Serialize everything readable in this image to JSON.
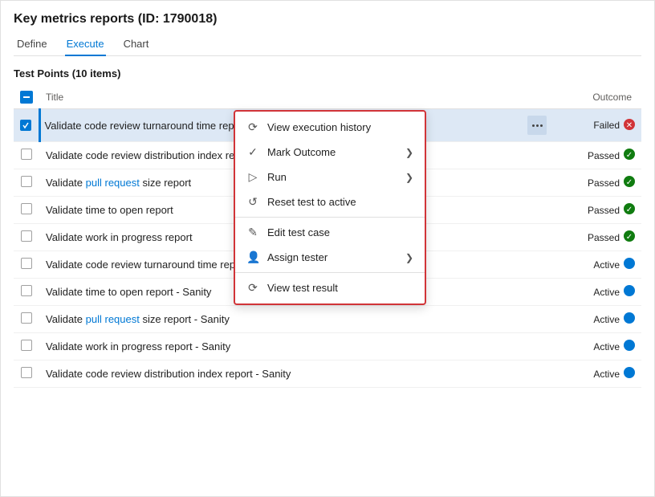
{
  "page": {
    "title": "Key metrics reports (ID: 1790018)"
  },
  "tabs": [
    {
      "id": "define",
      "label": "Define",
      "active": false
    },
    {
      "id": "execute",
      "label": "Execute",
      "active": true
    },
    {
      "id": "chart",
      "label": "Chart",
      "active": false
    }
  ],
  "section": {
    "title": "Test Points (10 items)"
  },
  "table": {
    "columns": [
      {
        "id": "checkbox",
        "label": ""
      },
      {
        "id": "title",
        "label": "Title"
      },
      {
        "id": "actions",
        "label": ""
      },
      {
        "id": "outcome",
        "label": "Outcome"
      }
    ],
    "rows": [
      {
        "id": 1,
        "title": "Validate code review turnaround time report - Data correctness",
        "titleLink": false,
        "selected": true,
        "checked": true,
        "outcome": "Failed",
        "outcomeType": "failed",
        "showMenu": true
      },
      {
        "id": 2,
        "title": "Validate code review distribution index report",
        "titleLink": false,
        "selected": false,
        "checked": false,
        "outcome": "Passed",
        "outcomeType": "passed",
        "showMenu": false
      },
      {
        "id": 3,
        "title": "Validate pull request size report",
        "titleLink": true,
        "selected": false,
        "checked": false,
        "outcome": "Passed",
        "outcomeType": "passed",
        "showMenu": false
      },
      {
        "id": 4,
        "title": "Validate time to open report",
        "titleLink": false,
        "selected": false,
        "checked": false,
        "outcome": "Passed",
        "outcomeType": "passed",
        "showMenu": false
      },
      {
        "id": 5,
        "title": "Validate work in progress report",
        "titleLink": false,
        "selected": false,
        "checked": false,
        "outcome": "Passed",
        "outcomeType": "passed",
        "showMenu": false
      },
      {
        "id": 6,
        "title": "Validate code review turnaround time report - Sanity",
        "titleLink": false,
        "selected": false,
        "checked": false,
        "outcome": "Active",
        "outcomeType": "active",
        "showMenu": false
      },
      {
        "id": 7,
        "title": "Validate time to open report - Sanity",
        "titleLink": false,
        "selected": false,
        "checked": false,
        "outcome": "Active",
        "outcomeType": "active",
        "showMenu": false
      },
      {
        "id": 8,
        "title": "Validate pull request size report - Sanity",
        "titleLink": false,
        "selected": false,
        "checked": false,
        "outcome": "Active",
        "outcomeType": "active",
        "showMenu": false
      },
      {
        "id": 9,
        "title": "Validate work in progress report - Sanity",
        "titleLink": false,
        "selected": false,
        "checked": false,
        "outcome": "Active",
        "outcomeType": "active",
        "showMenu": false
      },
      {
        "id": 10,
        "title": "Validate code review distribution index report - Sanity",
        "titleLink": false,
        "selected": false,
        "checked": false,
        "outcome": "Active",
        "outcomeType": "active",
        "showMenu": false
      }
    ]
  },
  "contextMenu": {
    "items": [
      {
        "id": "view-history",
        "label": "View execution history",
        "icon": "history",
        "hasArrow": false
      },
      {
        "id": "mark-outcome",
        "label": "Mark Outcome",
        "icon": "check",
        "hasArrow": true
      },
      {
        "id": "run",
        "label": "Run",
        "icon": "play",
        "hasArrow": true
      },
      {
        "id": "reset",
        "label": "Reset test to active",
        "icon": "reset",
        "hasArrow": false
      },
      {
        "id": "edit",
        "label": "Edit test case",
        "icon": "edit",
        "hasArrow": false
      },
      {
        "id": "assign",
        "label": "Assign tester",
        "icon": "person",
        "hasArrow": true
      },
      {
        "id": "view-result",
        "label": "View test result",
        "icon": "result",
        "hasArrow": false
      }
    ]
  },
  "colors": {
    "failed": "#d13438",
    "passed": "#107c10",
    "active": "#0078d4",
    "accent": "#0078d4"
  }
}
